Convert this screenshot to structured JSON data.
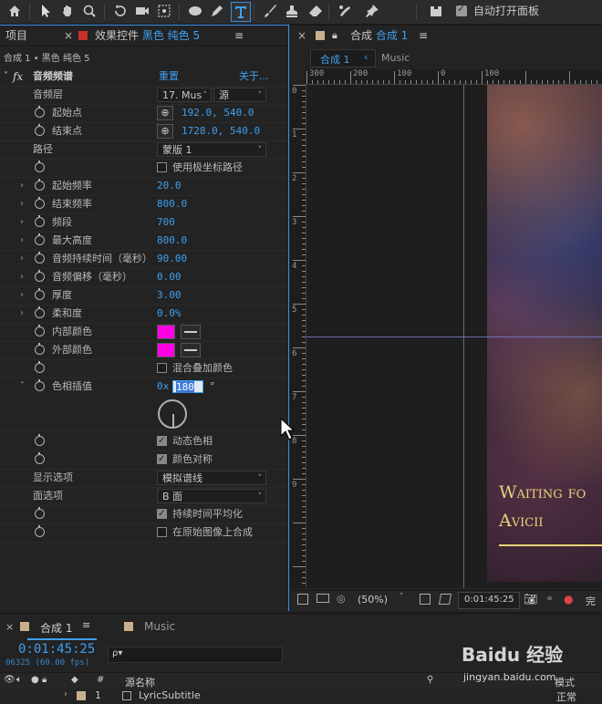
{
  "toolbar": {
    "auto_open_label": "自动打开面板",
    "tools": [
      "home-icon",
      "selection-icon",
      "hand-icon",
      "zoom-icon",
      "rotate-icon",
      "camera-icon",
      "pan-behind-icon",
      "ellipse-icon",
      "pen-icon",
      "type-icon",
      "brush-icon",
      "clone-stamp-icon",
      "eraser-icon",
      "roto-brush-icon",
      "puppet-pin-icon"
    ]
  },
  "effects_panel": {
    "project_tab": "项目",
    "effects_tab_prefix": "效果控件",
    "effects_tab_layer": "黑色 纯色 5",
    "breadcrumb": "合成 1 • 黑色 纯色 5",
    "effect_name": "音频频谱",
    "reset_label": "重置",
    "about_label": "关于...",
    "rows": [
      {
        "label": "音频层",
        "type": "dual-select",
        "value1": "17. Mus",
        "value2": "源"
      },
      {
        "label": "起始点",
        "type": "point",
        "value": "192.0, 540.0"
      },
      {
        "label": "结束点",
        "type": "point",
        "value": "1728.0, 540.0"
      },
      {
        "label": "路径",
        "type": "select",
        "value": "蒙版 1"
      },
      {
        "label": "",
        "type": "checkbox",
        "cb_label": "使用极坐标路径",
        "checked": false
      },
      {
        "label": "起始频率",
        "type": "value",
        "value": "20.0",
        "expand": true
      },
      {
        "label": "结束频率",
        "type": "value",
        "value": "800.0",
        "expand": true
      },
      {
        "label": "频段",
        "type": "value",
        "value": "700",
        "expand": true
      },
      {
        "label": "最大高度",
        "type": "value",
        "value": "800.0",
        "expand": true
      },
      {
        "label": "音频持续时间（毫秒）",
        "type": "value",
        "value": "90.00",
        "expand": true
      },
      {
        "label": "音频偏移（毫秒）",
        "type": "value",
        "value": "0.00",
        "expand": true
      },
      {
        "label": "厚度",
        "type": "value",
        "value": "3.00",
        "expand": true
      },
      {
        "label": "柔和度",
        "type": "value",
        "value": "0.0%",
        "expand": true
      },
      {
        "label": "内部颜色",
        "type": "color",
        "color": "#ff00e6"
      },
      {
        "label": "外部颜色",
        "type": "color",
        "color": "#ff00e6"
      },
      {
        "label": "",
        "type": "checkbox",
        "cb_label": "混合叠加颜色",
        "checked": false
      }
    ],
    "hue": {
      "label": "色相插值",
      "prefix": "0x",
      "value": "180",
      "unit": "°"
    },
    "rows2": [
      {
        "label": "",
        "type": "checkbox",
        "cb_label": "动态色相",
        "checked": true
      },
      {
        "label": "",
        "type": "checkbox",
        "cb_label": "颜色对称",
        "checked": true
      },
      {
        "label": "显示选项",
        "type": "select",
        "value": "模拟谱线"
      },
      {
        "label": "面选项",
        "type": "select",
        "value": "B 面"
      },
      {
        "label": "",
        "type": "checkbox",
        "cb_label": "持续时间平均化",
        "checked": true
      },
      {
        "label": "",
        "type": "checkbox",
        "cb_label": "在原始图像上合成",
        "checked": false
      }
    ]
  },
  "comp_panel": {
    "tab_prefix": "合成",
    "tab_name": "合成 1",
    "sub_tab_active": "合成 1",
    "sub_tab_other": "Music",
    "ruler_h": [
      "300",
      "200",
      "100",
      "0",
      "100"
    ],
    "ruler_v": [
      "0",
      "1",
      "2",
      "3",
      "4",
      "5",
      "6",
      "7",
      "8",
      "9"
    ],
    "title_line1": "Waiting fo",
    "title_line2": "Avicii",
    "footer_zoom": "(50%)",
    "footer_time": "0:01:45:25",
    "footer_quality": "完"
  },
  "timeline": {
    "tab1": "合成 1",
    "tab2": "Music",
    "timecode": "0:01:45:25",
    "frames": "06325 (60.00 fps)",
    "search_placeholder": "ρ▾",
    "col_layer_name": "源名称",
    "col_mode": "模式",
    "layer_num": "1",
    "layer_name": "LyricSubtitle",
    "layer_mode": "正常"
  },
  "watermark": {
    "text": "Baidu 经验",
    "sub": "jingyan.baidu.com"
  },
  "colors": {
    "accent": "#3da0f0",
    "panel_border": "#3a8ee6",
    "color_swatch": "#ff00e6",
    "title_gold": "#e8d27a"
  }
}
